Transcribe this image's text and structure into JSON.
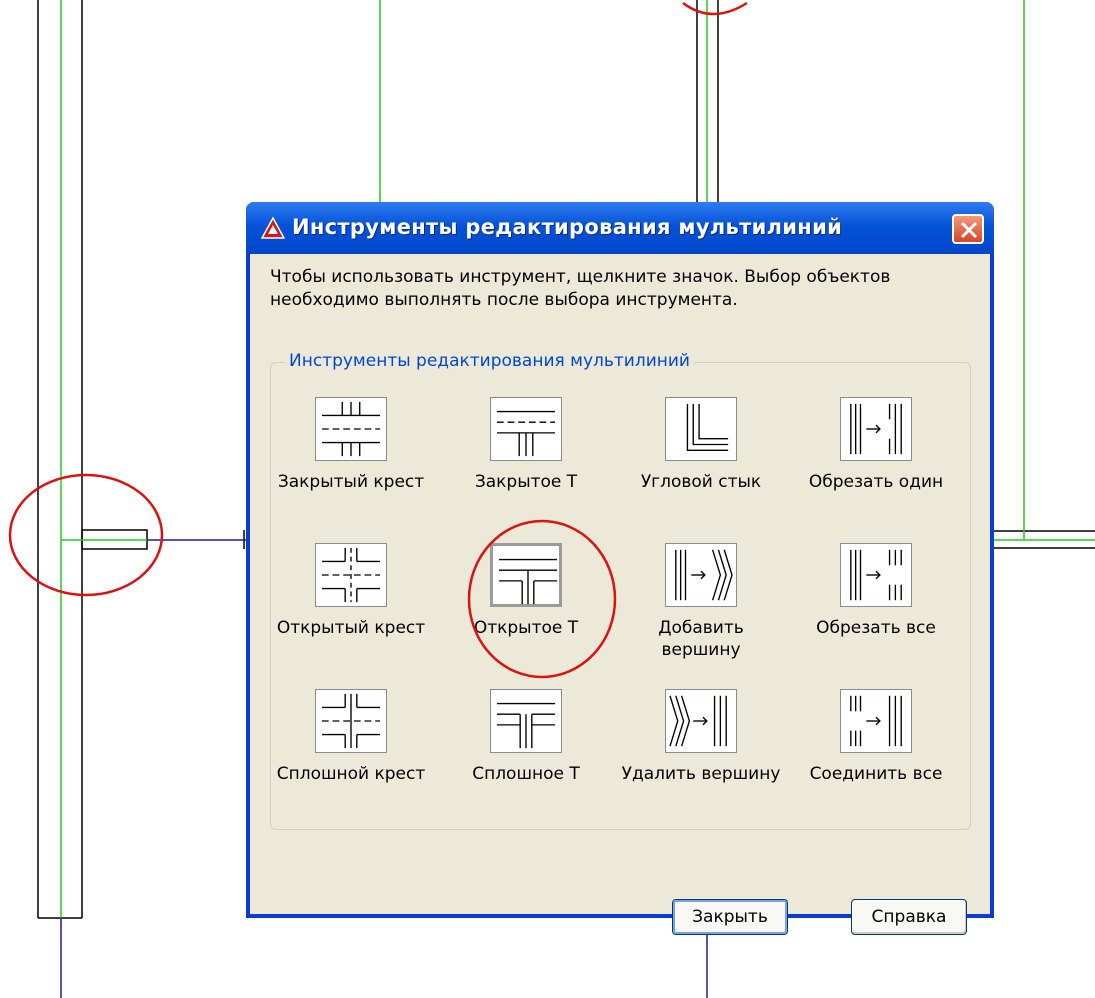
{
  "dialog": {
    "title": "Инструменты редактирования мультилиний",
    "description": "Чтобы использовать инструмент, щелкните значок.  Выбор объектов необходимо выполнять после выбора инструмента.",
    "group_label": "Инструменты редактирования мультилиний",
    "tools": [
      {
        "label": "Закрытый крест",
        "icon": "closed-cross-icon"
      },
      {
        "label": "Закрытое Т",
        "icon": "closed-tee-icon"
      },
      {
        "label": "Угловой стык",
        "icon": "corner-joint-icon"
      },
      {
        "label": "Обрезать один",
        "icon": "cut-single-icon"
      },
      {
        "label": "Открытый крест",
        "icon": "open-cross-icon"
      },
      {
        "label": "Открытое Т",
        "icon": "open-tee-icon",
        "selected": true
      },
      {
        "label": "Добавить вершину",
        "icon": "add-vertex-icon"
      },
      {
        "label": "Обрезать все",
        "icon": "cut-all-icon"
      },
      {
        "label": "Сплошной крест",
        "icon": "merged-cross-icon"
      },
      {
        "label": "Сплошное Т",
        "icon": "merged-tee-icon"
      },
      {
        "label": "Удалить вершину",
        "icon": "delete-vertex-icon"
      },
      {
        "label": "Соединить все",
        "icon": "weld-all-icon"
      }
    ],
    "buttons": {
      "close": "Закрыть",
      "help": "Справка"
    }
  },
  "colors": {
    "titlebar": "#0553d8",
    "close": "#d4452a",
    "annotation": "#dd1111",
    "guide": "#22cc22",
    "axis": "#1a1aa0"
  }
}
